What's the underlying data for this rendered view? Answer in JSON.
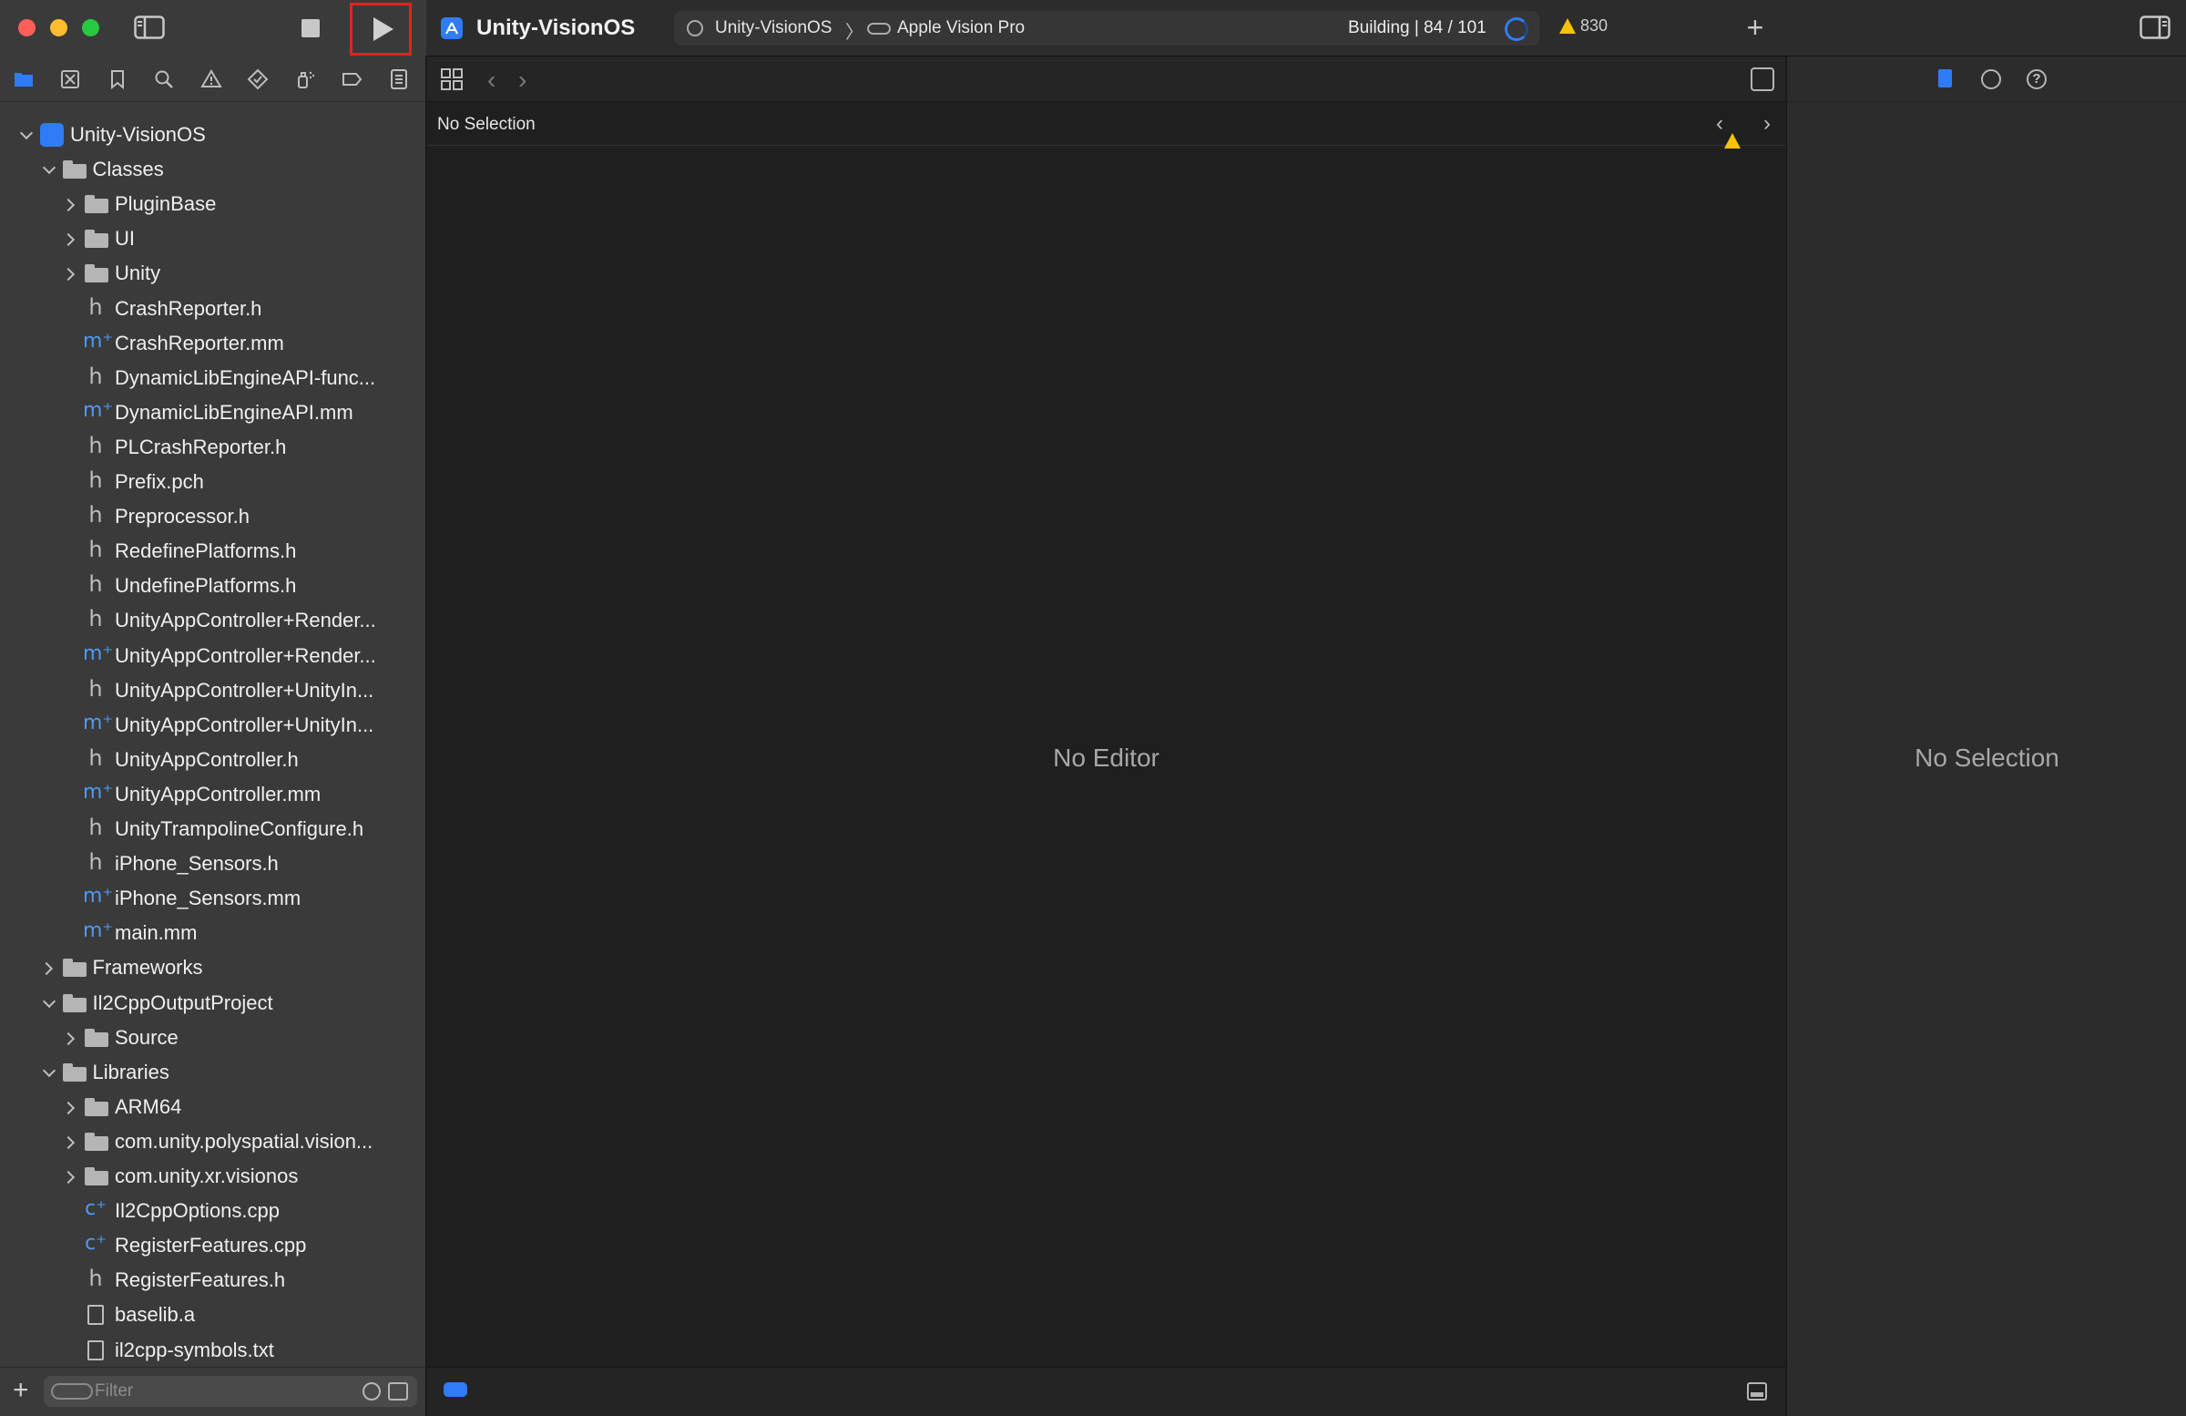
{
  "window": {
    "project_title": "Unity-VisionOS",
    "scheme": "Unity-VisionOS",
    "scheme_chevron": "〉",
    "device": "Apple Vision Pro",
    "build_status": "Building | 84 / 101",
    "warning_count": "830",
    "add_tab_glyph": "+",
    "accent_color": "#2f7cf6",
    "run_highlight_color": "#e0241b"
  },
  "navigator": {
    "tabs": [
      "project-navigator",
      "source-control-navigator",
      "bookmark-navigator",
      "find-navigator",
      "issue-navigator",
      "test-navigator",
      "debug-navigator",
      "breakpoint-navigator",
      "report-navigator"
    ],
    "tree": [
      {
        "name": "Unity-VisionOS",
        "kind": "project",
        "depth": 0,
        "expanded": true
      },
      {
        "name": "Classes",
        "kind": "folder",
        "depth": 1,
        "expanded": true
      },
      {
        "name": "PluginBase",
        "kind": "folder",
        "depth": 2,
        "expanded": false
      },
      {
        "name": "UI",
        "kind": "folder",
        "depth": 2,
        "expanded": false
      },
      {
        "name": "Unity",
        "kind": "folder",
        "depth": 2,
        "expanded": false
      },
      {
        "name": "CrashReporter.h",
        "kind": "h",
        "depth": 2
      },
      {
        "name": "CrashReporter.mm",
        "kind": "m",
        "depth": 2
      },
      {
        "name": "DynamicLibEngineAPI-func...",
        "kind": "h",
        "depth": 2
      },
      {
        "name": "DynamicLibEngineAPI.mm",
        "kind": "m",
        "depth": 2
      },
      {
        "name": "PLCrashReporter.h",
        "kind": "h",
        "depth": 2
      },
      {
        "name": "Prefix.pch",
        "kind": "h",
        "depth": 2
      },
      {
        "name": "Preprocessor.h",
        "kind": "h",
        "depth": 2
      },
      {
        "name": "RedefinePlatforms.h",
        "kind": "h",
        "depth": 2
      },
      {
        "name": "UndefinePlatforms.h",
        "kind": "h",
        "depth": 2
      },
      {
        "name": "UnityAppController+Render...",
        "kind": "h",
        "depth": 2
      },
      {
        "name": "UnityAppController+Render...",
        "kind": "m",
        "depth": 2
      },
      {
        "name": "UnityAppController+UnityIn...",
        "kind": "h",
        "depth": 2
      },
      {
        "name": "UnityAppController+UnityIn...",
        "kind": "m",
        "depth": 2
      },
      {
        "name": "UnityAppController.h",
        "kind": "h",
        "depth": 2
      },
      {
        "name": "UnityAppController.mm",
        "kind": "m",
        "depth": 2
      },
      {
        "name": "UnityTrampolineConfigure.h",
        "kind": "h",
        "depth": 2
      },
      {
        "name": "iPhone_Sensors.h",
        "kind": "h",
        "depth": 2
      },
      {
        "name": "iPhone_Sensors.mm",
        "kind": "m",
        "depth": 2
      },
      {
        "name": "main.mm",
        "kind": "m",
        "depth": 2
      },
      {
        "name": "Frameworks",
        "kind": "folder",
        "depth": 1,
        "expanded": false
      },
      {
        "name": "Il2CppOutputProject",
        "kind": "folder",
        "depth": 1,
        "expanded": true
      },
      {
        "name": "Source",
        "kind": "folder",
        "depth": 2,
        "expanded": false
      },
      {
        "name": "Libraries",
        "kind": "folder",
        "depth": 1,
        "expanded": true
      },
      {
        "name": "ARM64",
        "kind": "folder",
        "depth": 2,
        "expanded": false
      },
      {
        "name": "com.unity.polyspatial.vision...",
        "kind": "folder",
        "depth": 2,
        "expanded": false
      },
      {
        "name": "com.unity.xr.visionos",
        "kind": "folder",
        "depth": 2,
        "expanded": false
      },
      {
        "name": "Il2CppOptions.cpp",
        "kind": "c",
        "depth": 2
      },
      {
        "name": "RegisterFeatures.cpp",
        "kind": "c",
        "depth": 2
      },
      {
        "name": "RegisterFeatures.h",
        "kind": "h",
        "depth": 2
      },
      {
        "name": "baselib.a",
        "kind": "doc",
        "depth": 2
      },
      {
        "name": "il2cpp-symbols.txt",
        "kind": "txt",
        "depth": 2
      }
    ],
    "filter_placeholder": "Filter",
    "add_glyph": "+"
  },
  "editor": {
    "jump_bar_label": "No Selection",
    "placeholder": "No Editor",
    "back_glyph": "‹",
    "forward_glyph": "›"
  },
  "inspector": {
    "placeholder": "No Selection",
    "help_glyph": "?"
  }
}
